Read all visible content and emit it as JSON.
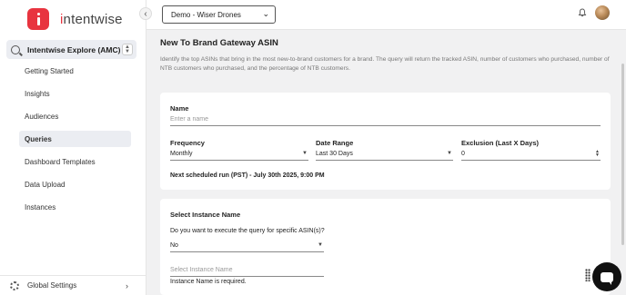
{
  "brand": {
    "name_prefix": "i",
    "name_rest": "ntentwise"
  },
  "sidebar": {
    "module_label": "Intentwise Explore (AMC)",
    "items": [
      {
        "label": "Getting Started"
      },
      {
        "label": "Insights"
      },
      {
        "label": "Audiences"
      },
      {
        "label": "Queries",
        "active": true
      },
      {
        "label": "Dashboard Templates"
      },
      {
        "label": "Data Upload"
      },
      {
        "label": "Instances"
      }
    ],
    "footer_label": "Global Settings"
  },
  "topbar": {
    "account_selected": "Demo - Wiser Drones"
  },
  "page": {
    "title": "New To Brand Gateway ASIN",
    "description": "Identify the top ASINs that bring in the most new-to-brand customers for a brand. The query will return the tracked ASIN, number of customers who purchased, number of NTB customers who purchased, and the percentage of NTB customers."
  },
  "form": {
    "name_label": "Name",
    "name_placeholder": "Enter a name",
    "frequency_label": "Frequency",
    "frequency_value": "Monthly",
    "date_range_label": "Date Range",
    "date_range_value": "Last 30 Days",
    "exclusion_label": "Exclusion (Last X Days)",
    "exclusion_value": "0",
    "next_run": "Next scheduled run (PST) - July 30th 2025, 9:00 PM"
  },
  "instance": {
    "section_title": "Select Instance Name",
    "asin_question": "Do you want to execute the query for specific ASIN(s)?",
    "asin_answer": "No",
    "instance_placeholder": "Select Instance Name",
    "error_text": "Instance Name is required."
  },
  "icons": {
    "collapse": "chevron-left-icon",
    "module": "search-icon",
    "settings": "gear-icon",
    "notifications": "bell-icon",
    "support": "chat-icon"
  },
  "colors": {
    "brand_red": "#e8343f",
    "active_bg": "#ebedf2"
  }
}
